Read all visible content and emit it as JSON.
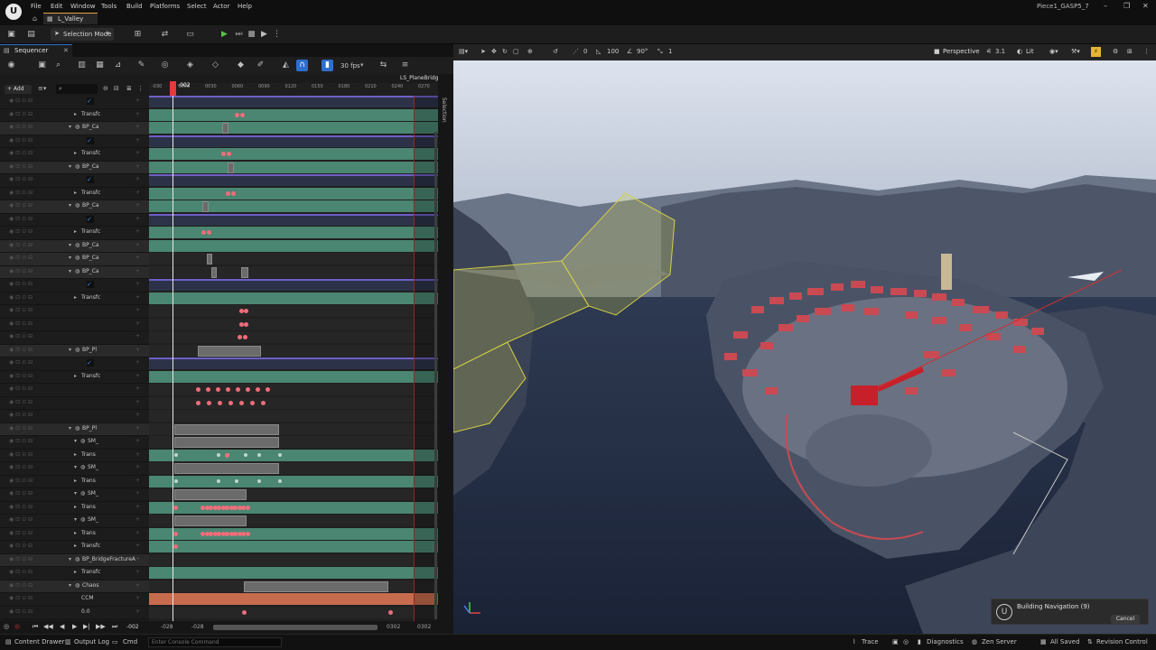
{
  "titlebar": {
    "tab": "L_Valley",
    "project": "Piece1_GASP5_7",
    "menu": [
      "File",
      "Edit",
      "Window",
      "Tools",
      "Build",
      "Platforms",
      "Select",
      "Actor",
      "Help"
    ]
  },
  "toolbar": {
    "selection_mode": "Selection Mode"
  },
  "sequencer": {
    "tab": "Sequencer",
    "fps": "30 fps",
    "add_label": "+ Add",
    "sequence_name": "LS_PlaneBridge",
    "current_frame": "-002",
    "side_tab": "Selection",
    "ticks": [
      "-030",
      "0000",
      "0030",
      "0060",
      "0090",
      "0120",
      "0150",
      "0180",
      "0210",
      "0240",
      "0270"
    ],
    "rows": [
      {
        "label": ""
      },
      {
        "label": "Transfc"
      },
      {
        "label": "BP_Ca"
      },
      {
        "label": ""
      },
      {
        "label": "Transfc"
      },
      {
        "label": "BP_Ca"
      },
      {
        "label": ""
      },
      {
        "label": "Transfc"
      },
      {
        "label": "BP_Ca"
      },
      {
        "label": ""
      },
      {
        "label": "Transfc"
      },
      {
        "label": "BP_Ca"
      },
      {
        "label": "BP_Ca"
      },
      {
        "label": "BP_Ca"
      },
      {
        "label": ""
      },
      {
        "label": "Transfc"
      },
      {
        "label": ""
      },
      {
        "label": ""
      },
      {
        "label": ""
      },
      {
        "label": "BP_Pl"
      },
      {
        "label": ""
      },
      {
        "label": "Transfc"
      },
      {
        "label": ""
      },
      {
        "label": ""
      },
      {
        "label": ""
      },
      {
        "label": "BP_Pl"
      },
      {
        "label": "SM_"
      },
      {
        "label": "Trans"
      },
      {
        "label": "SM_"
      },
      {
        "label": "Trans"
      },
      {
        "label": "SM_"
      },
      {
        "label": "Trans"
      },
      {
        "label": "SM_"
      },
      {
        "label": "Trans"
      },
      {
        "label": "Transfc"
      },
      {
        "label": "BP_BridgeFractureA"
      },
      {
        "label": "Transfc"
      },
      {
        "label": "Chaos"
      },
      {
        "label": "CCM"
      },
      {
        "label": "0.0"
      }
    ],
    "bottom": {
      "frame": "-002",
      "left": "-028",
      "mid": "-028",
      "right1": "0302",
      "right2": "0302"
    }
  },
  "viewport": {
    "perspective": "Perspective",
    "lit": "Lit",
    "speed": "3.1",
    "zoom": "100",
    "angle": "90°",
    "grid": "0",
    "scale": "1"
  },
  "statusbar": {
    "content_drawer": "Content Drawer",
    "output_log": "Output Log",
    "cmd": "Cmd",
    "console_placeholder": "Enter Console Command",
    "trace": "Trace",
    "diagnostics": "Diagnostics",
    "zen": "Zen Server",
    "saved": "All Saved",
    "revision": "Revision Control"
  },
  "toast": {
    "text": "Building Navigation (9)",
    "cancel": "Cancel"
  }
}
